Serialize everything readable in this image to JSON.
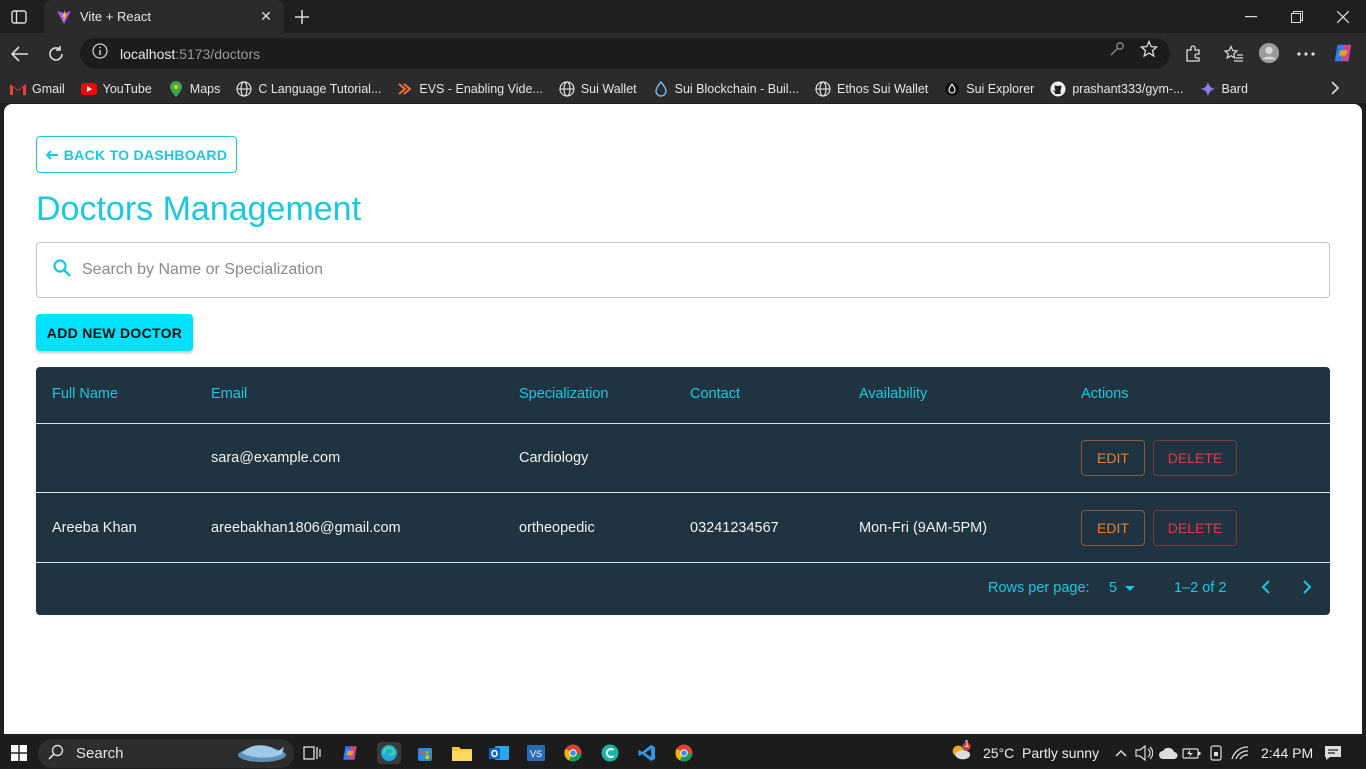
{
  "browser": {
    "tab_title": "Vite + React",
    "url_host": "localhost",
    "url_rest": ":5173/doctors",
    "bookmarks": [
      {
        "label": "Gmail",
        "icon": "gmail-icon"
      },
      {
        "label": "YouTube",
        "icon": "youtube-icon"
      },
      {
        "label": "Maps",
        "icon": "maps-icon"
      },
      {
        "label": "C Language Tutorial...",
        "icon": "globe-icon"
      },
      {
        "label": "EVS - Enabling Vide...",
        "icon": "evs-icon"
      },
      {
        "label": "Sui Wallet",
        "icon": "globe-icon"
      },
      {
        "label": "Sui Blockchain - Buil...",
        "icon": "sui-drop-icon"
      },
      {
        "label": "Ethos Sui Wallet",
        "icon": "globe-icon"
      },
      {
        "label": "Sui Explorer",
        "icon": "sui-drop-icon"
      },
      {
        "label": "prashant333/gym-...",
        "icon": "github-icon"
      },
      {
        "label": "Bard",
        "icon": "bard-icon"
      }
    ]
  },
  "page": {
    "back_label": "BACK TO DASHBOARD",
    "title": "Doctors Management",
    "search_placeholder": "Search by Name or Specialization",
    "add_label": "ADD NEW DOCTOR"
  },
  "table": {
    "headers": [
      "Full Name",
      "Email",
      "Specialization",
      "Contact",
      "Availability",
      "Actions"
    ],
    "rows": [
      {
        "name": "",
        "email": "sara@example.com",
        "specialization": "Cardiology",
        "contact": "",
        "availability": ""
      },
      {
        "name": "Areeba Khan",
        "email": "areebakhan1806@gmail.com",
        "specialization": "ortheopedic",
        "contact": "03241234567",
        "availability": "Mon-Fri (9AM-5PM)"
      }
    ],
    "edit_label": "EDIT",
    "delete_label": "DELETE",
    "rows_per_page_label": "Rows per page:",
    "rows_per_page_value": "5",
    "range_label": "1–2 of 2"
  },
  "taskbar": {
    "search_label": "Search",
    "weather": "25°C  Partly sunny",
    "weather_badge": "1",
    "time": "2:44 PM"
  },
  "colors": {
    "accent": "#1bc8e0",
    "button_fill": "#00e1ff",
    "table_bg": "#1f3340",
    "edit": "#f07d2a",
    "delete": "#e0394a"
  }
}
